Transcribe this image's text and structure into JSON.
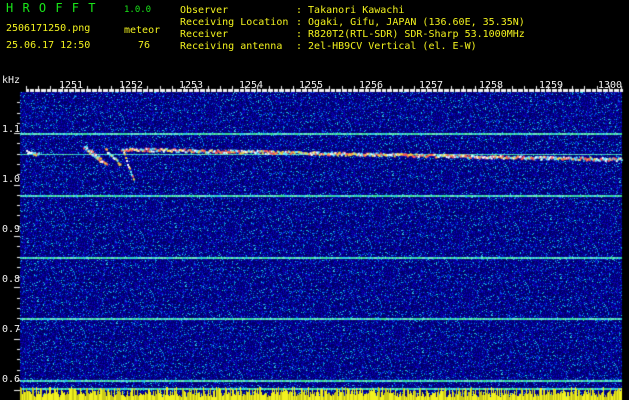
{
  "header": {
    "app_name": "H R O F F T",
    "version": "1.0.0",
    "filename": "2506171250.png",
    "timestamp": "25.06.17 12:50",
    "event_label": "meteor",
    "event_count": "76"
  },
  "info": [
    {
      "label": "Observer",
      "value": ": Takanori Kawachi"
    },
    {
      "label": "Receiving Location",
      "value": ": Ogaki, Gifu, JAPAN (136.60E, 35.35N)"
    },
    {
      "label": "Receiver",
      "value": ": R820T2(RTL-SDR) SDR-Sharp 53.1000MHz"
    },
    {
      "label": "Receiving antenna",
      "value": ": 2el-HB9CV Vertical (el. E-W)"
    }
  ],
  "colors": {
    "text": "#f2f21e",
    "title": "#19e619",
    "axis": "#f0f0f0",
    "background": "#000000"
  },
  "chart_data": {
    "type": "heatmap",
    "x_unit_label": "",
    "y_unit_label": "kHz",
    "x_ticks": [
      "1251",
      "1252",
      "1253",
      "1254",
      "1255",
      "1256",
      "1257",
      "1258",
      "1259",
      "1300"
    ],
    "y_ticks": [
      "1.1",
      "1.0",
      "0.9",
      "0.8",
      "0.7",
      "0.6"
    ],
    "y_tick_values": [
      1.1,
      1.0,
      0.9,
      0.8,
      0.7,
      0.6
    ],
    "ylim": [
      0.585,
      1.18
    ],
    "xlim": [
      1250.5,
      1300.1
    ],
    "carrier_lines_khz": [
      1.1,
      1.06,
      0.98,
      0.86,
      0.74,
      0.62,
      0.605
    ],
    "meteor_traces": [
      {
        "x": [
          1251.0,
          1252.0
        ],
        "y": [
          1.065,
          1.06
        ]
      },
      {
        "x": [
          1255.7,
          1257.2
        ],
        "y": [
          1.075,
          1.045
        ]
      },
      {
        "x": [
          1256.2,
          1257.6
        ],
        "y": [
          1.07,
          1.04
        ]
      },
      {
        "x": [
          1257.5,
          1258.7
        ],
        "y": [
          1.07,
          1.04
        ]
      },
      {
        "x": [
          1258.8,
          1300.0
        ],
        "y": [
          1.07,
          1.05
        ]
      },
      {
        "x": [
          1259.0,
          1259.8
        ],
        "y": [
          1.065,
          1.01
        ]
      }
    ],
    "grid": false,
    "legend": "none"
  }
}
